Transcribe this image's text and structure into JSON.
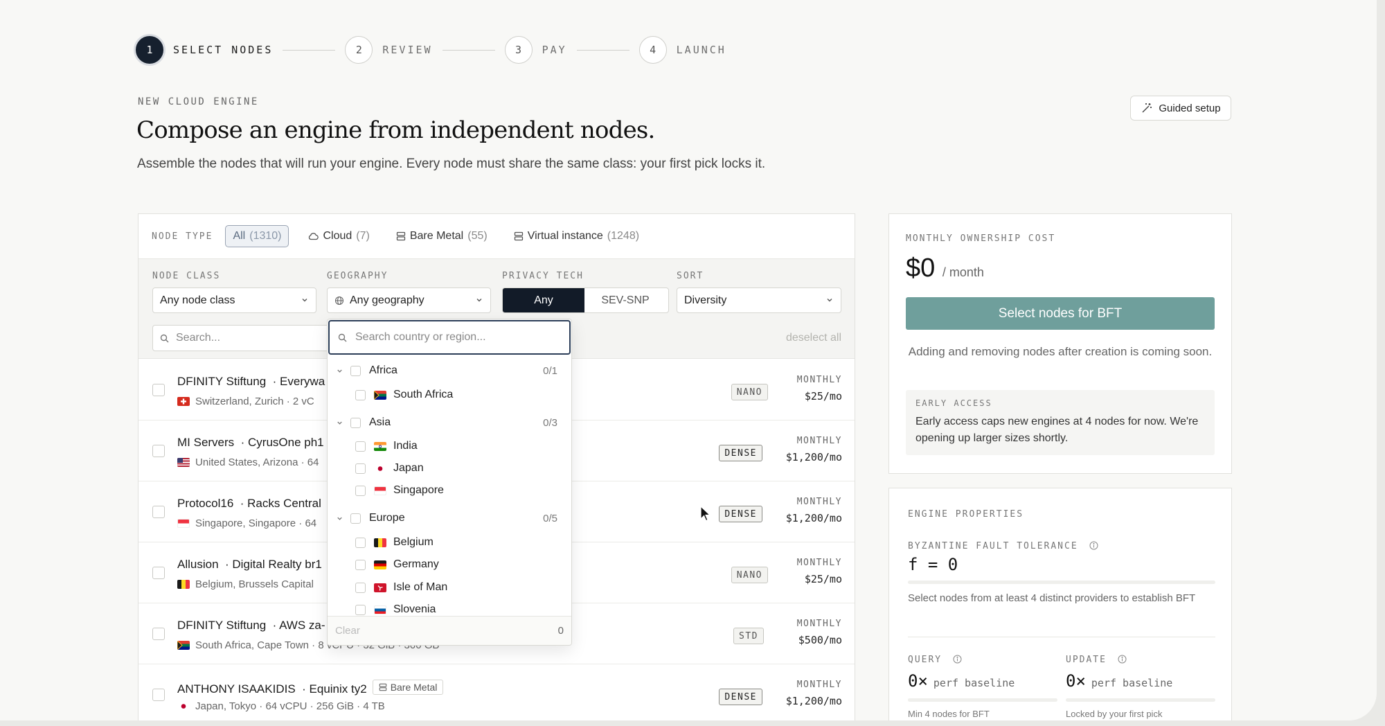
{
  "stepper": [
    {
      "num": "1",
      "label": "SELECT NODES"
    },
    {
      "num": "2",
      "label": "REVIEW"
    },
    {
      "num": "3",
      "label": "PAY"
    },
    {
      "num": "4",
      "label": "LAUNCH"
    }
  ],
  "header": {
    "eyebrow": "NEW CLOUD ENGINE",
    "title": "Compose an engine from independent nodes.",
    "description": "Assemble the nodes that will run your engine. Every node must share the same class: your first pick locks it.",
    "guided_setup": "Guided setup"
  },
  "node_type": {
    "label": "NODE TYPE",
    "options": [
      {
        "label": "All",
        "count": "(1310)"
      },
      {
        "label": "Cloud",
        "count": "(7)"
      },
      {
        "label": "Bare Metal",
        "count": "(55)"
      },
      {
        "label": "Virtual instance",
        "count": "(1248)"
      }
    ]
  },
  "filters": {
    "node_class": {
      "label": "NODE CLASS",
      "value": "Any node class"
    },
    "geography": {
      "label": "GEOGRAPHY",
      "value": "Any geography"
    },
    "privacy": {
      "label": "PRIVACY TECH",
      "options": [
        "Any",
        "SEV-SNP"
      ]
    },
    "sort": {
      "label": "SORT",
      "value": "Diversity"
    },
    "search_placeholder": "Search...",
    "deselect_all": "deselect all"
  },
  "nodes": [
    {
      "provider": "DFINITY Stiftung",
      "dc": "· Everywa",
      "location": "Switzerland, Zurich · 2 vC",
      "class": "NANO",
      "monthly_label": "MONTHLY",
      "price": "$25/mo"
    },
    {
      "provider": "MI Servers",
      "dc": "· CyrusOne ph1",
      "location": "United States, Arizona · 64",
      "class": "DENSE",
      "monthly_label": "MONTHLY",
      "price": "$1,200/mo"
    },
    {
      "provider": "Protocol16",
      "dc": "· Racks Central",
      "location": "Singapore, Singapore · 64",
      "class": "DENSE",
      "monthly_label": "MONTHLY",
      "price": "$1,200/mo"
    },
    {
      "provider": "Allusion",
      "dc": "· Digital Realty br1",
      "location": "Belgium, Brussels Capital",
      "class": "NANO",
      "monthly_label": "MONTHLY",
      "price": "$25/mo"
    },
    {
      "provider": "DFINITY Stiftung",
      "dc": "· AWS za-",
      "location": "South Africa, Cape Town · 8 vCPU · 32 GiB · 300 GB",
      "class": "STD",
      "monthly_label": "MONTHLY",
      "price": "$500/mo"
    },
    {
      "provider": "ANTHONY ISAAKIDIS",
      "dc": "· Equinix ty2",
      "tag": "Bare Metal",
      "location": "Japan, Tokyo · 64 vCPU · 256 GiB · 4 TB",
      "class": "DENSE",
      "monthly_label": "MONTHLY",
      "price": "$1,200/mo"
    }
  ],
  "geo_dropdown": {
    "search_placeholder": "Search country or region...",
    "regions": [
      {
        "name": "Africa",
        "count": "0/1",
        "countries": [
          "South Africa"
        ]
      },
      {
        "name": "Asia",
        "count": "0/3",
        "countries": [
          "India",
          "Japan",
          "Singapore"
        ]
      },
      {
        "name": "Europe",
        "count": "0/5",
        "countries": [
          "Belgium",
          "Germany",
          "Isle of Man",
          "Slovenia"
        ]
      }
    ],
    "clear": "Clear",
    "selected_count": "0"
  },
  "cost": {
    "label": "MONTHLY OWNERSHIP COST",
    "amount": "$0",
    "unit": "/ month",
    "cta": "Select nodes for BFT",
    "coming_soon": "Adding and removing nodes after creation is coming soon.",
    "early_label": "EARLY ACCESS",
    "early_text": "Early access caps new engines at 4 nodes for now. We're opening up larger sizes shortly."
  },
  "properties": {
    "label": "ENGINE PROPERTIES",
    "bft_label": "BYZANTINE FAULT TOLERANCE",
    "bft_value": "f = 0",
    "bft_desc": "Select nodes from at least 4 distinct providers to establish BFT",
    "query_label": "QUERY",
    "query_value": "0×",
    "query_sub": "perf baseline",
    "query_note": "Min 4 nodes for BFT",
    "update_label": "UPDATE",
    "update_value": "0×",
    "update_sub": "perf baseline",
    "update_note": "Locked by your first pick"
  },
  "colors": {
    "primary_dark": "#16202e",
    "cta_teal": "#6f9f9c",
    "background": "#f8f8f6"
  }
}
